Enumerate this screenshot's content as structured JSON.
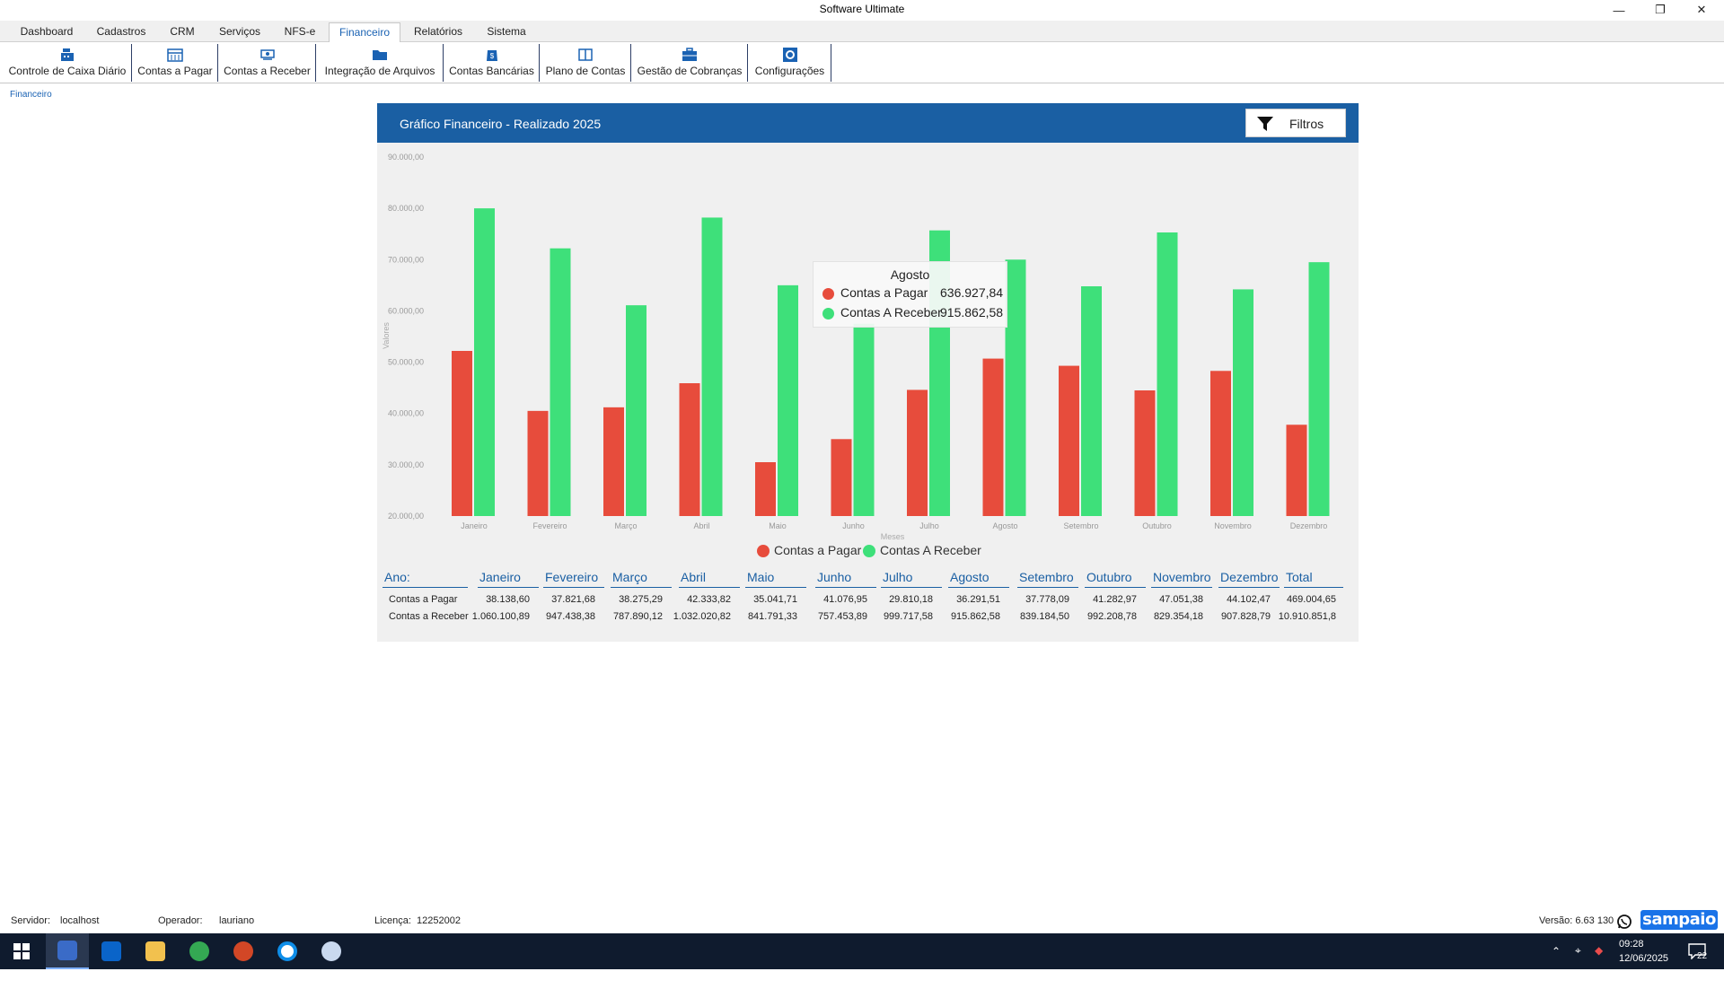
{
  "window": {
    "title": "Software Ultimate"
  },
  "menu_tabs": [
    "Dashboard",
    "Cadastros",
    "CRM",
    "Serviços",
    "NFS-e",
    "Financeiro",
    "Relatórios",
    "Sistema"
  ],
  "active_tab": "Financeiro",
  "toolbar": [
    {
      "label": "Controle de Caixa Diário",
      "icon": "cash-register-icon"
    },
    {
      "label": "Contas a Pagar",
      "icon": "calendar-icon"
    },
    {
      "label": "Contas a Receber",
      "icon": "money-icon"
    },
    {
      "label": "Integração de Arquivos",
      "icon": "folder-icon"
    },
    {
      "label": "Contas Bancárias",
      "icon": "bank-icon"
    },
    {
      "label": "Plano de Contas",
      "icon": "book-icon"
    },
    {
      "label": "Gestão de Cobranças",
      "icon": "briefcase-icon"
    },
    {
      "label": "Configurações",
      "icon": "gear-icon"
    }
  ],
  "breadcrumb": "Financeiro",
  "panel": {
    "title": "Gráfico Financeiro - Realizado 2025",
    "filter_label": "Filtros"
  },
  "colors": {
    "pagar": "#e74c3c",
    "receber": "#3ee07a",
    "header": "#1a5fa3"
  },
  "chart_data": {
    "type": "bar",
    "categories": [
      "Janeiro",
      "Fevereiro",
      "Março",
      "Abril",
      "Maio",
      "Junho",
      "Julho",
      "Agosto",
      "Setembro",
      "Outubro",
      "Novembro",
      "Dezembro"
    ],
    "series": [
      {
        "name": "Contas a Pagar",
        "values": [
          52200,
          40500,
          41200,
          45900,
          30500,
          35000,
          44600,
          50700,
          49300,
          44500,
          48300,
          37800
        ]
      },
      {
        "name": "Contas A Receber",
        "values": [
          80000,
          72200,
          61100,
          78200,
          65000,
          57500,
          75700,
          70000,
          64800,
          75300,
          64200,
          69500
        ]
      }
    ],
    "ylim": [
      20000,
      90000
    ],
    "yticks": [
      "20.000,00",
      "30.000,00",
      "40.000,00",
      "50.000,00",
      "60.000,00",
      "70.000,00",
      "80.000,00",
      "90.000,00"
    ],
    "ylabel": "Valores",
    "xlabel": "Meses",
    "legend": [
      "Contas a Pagar",
      "Contas A Receber"
    ],
    "grid": false,
    "legend_position": "bottom"
  },
  "tooltip": {
    "title": "Agosto",
    "rows": [
      {
        "name": "Contas a Pagar",
        "value": "636.927,84"
      },
      {
        "name": "Contas A Receber",
        "value": "915.862,58"
      }
    ]
  },
  "summary": {
    "year_label": "Ano:",
    "headers": [
      "Janeiro",
      "Fevereiro",
      "Março",
      "Abril",
      "Maio",
      "Junho",
      "Julho",
      "Agosto",
      "Setembro",
      "Outubro",
      "Novembro",
      "Dezembro",
      "Total"
    ],
    "rows": [
      {
        "label": "Contas a Pagar",
        "values": [
          "38.138,60",
          "37.821,68",
          "38.275,29",
          "42.333,82",
          "35.041,71",
          "41.076,95",
          "29.810,18",
          "36.291,51",
          "37.778,09",
          "41.282,97",
          "47.051,38",
          "44.102,47",
          "469.004,65"
        ]
      },
      {
        "label": "Contas a Receber",
        "values": [
          "1.060.100,89",
          "947.438,38",
          "787.890,12",
          "1.032.020,82",
          "841.791,33",
          "757.453,89",
          "999.717,58",
          "915.862,58",
          "839.184,50",
          "992.208,78",
          "829.354,18",
          "907.828,79",
          "10.910.851,8"
        ]
      }
    ]
  },
  "status": {
    "server_label": "Servidor:",
    "server": "localhost",
    "operator_label": "Operador:",
    "operator": "lauriano",
    "license_label": "Licença:",
    "license": "12252002",
    "version": "Versão: 6.63 130",
    "brand": "sampaio"
  },
  "taskbar": {
    "time": "09:28",
    "date": "12/06/2025",
    "notifications": "22",
    "apps": [
      "start-icon",
      "ultimate-app-icon",
      "outlook-icon",
      "file-explorer-icon",
      "chrome-icon",
      "powerpoint-icon",
      "teamviewer-icon",
      "paint-icon"
    ]
  }
}
